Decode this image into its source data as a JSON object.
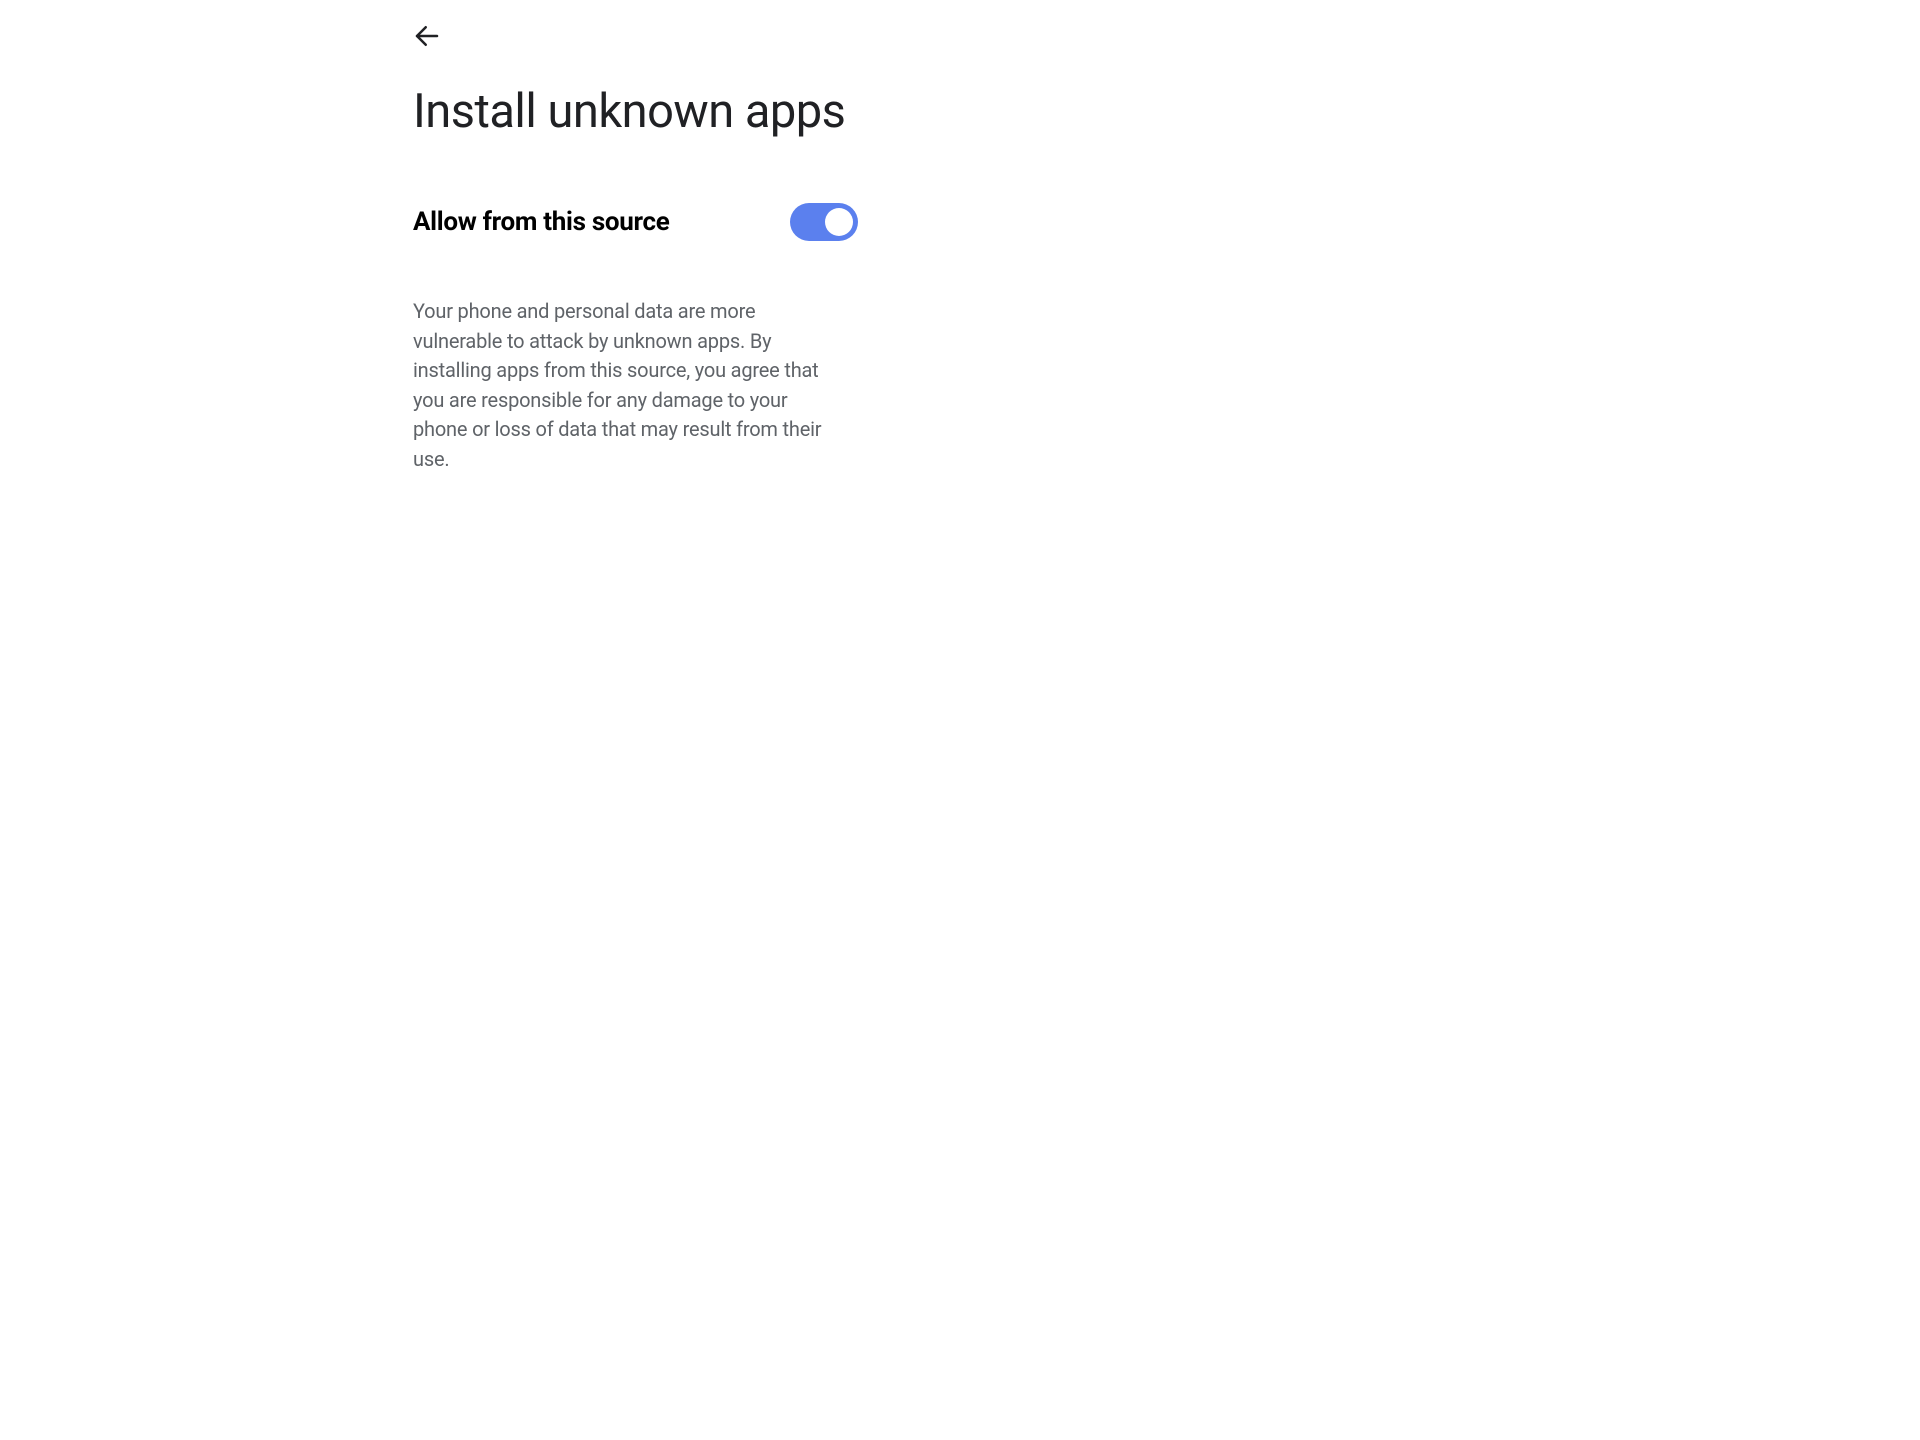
{
  "header": {
    "back_icon": "arrow-back-icon",
    "title": "Install unknown apps"
  },
  "setting": {
    "label": "Allow from this source",
    "enabled": true
  },
  "warning": {
    "text": "Your phone and personal data are more vulnerable to attack by unknown apps. By installing apps from this source, you agree that you are responsible for any damage to your phone or loss of data that may result from their use."
  },
  "colors": {
    "toggle_on": "#5b80ee",
    "text_primary": "#202124",
    "text_secondary": "#5f6368"
  }
}
